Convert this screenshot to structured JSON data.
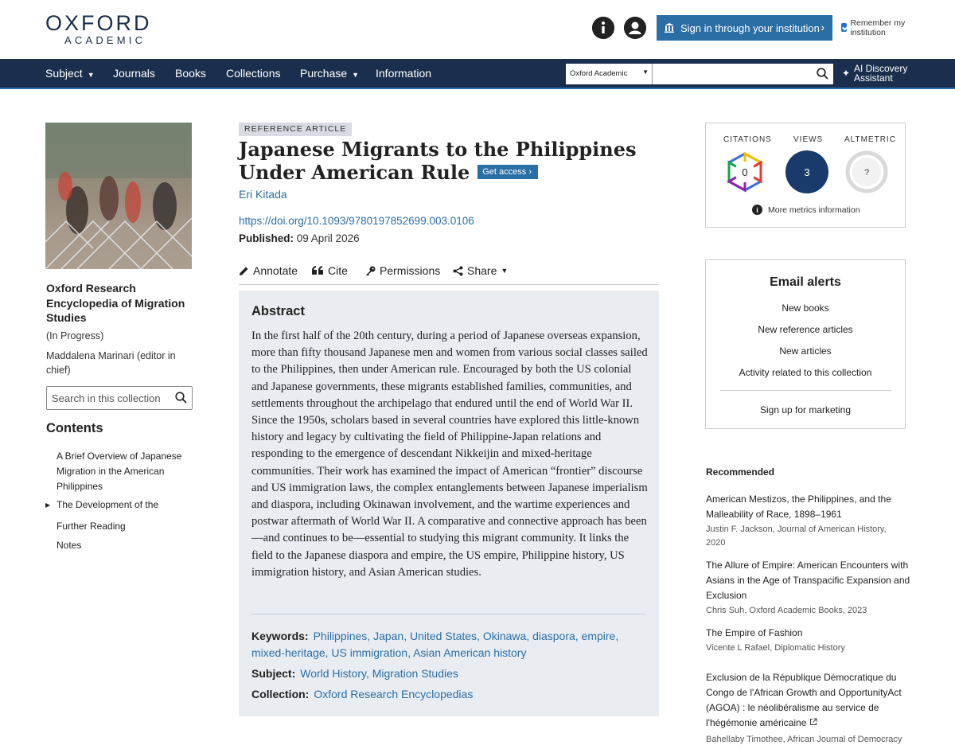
{
  "header": {
    "logo_top": "OXFORD",
    "logo_bottom": "ACADEMIC",
    "signin_label": "Sign in through your institution",
    "remember_label": "Remember my institution"
  },
  "nav": {
    "items": [
      "Subject",
      "Journals",
      "Books",
      "Collections",
      "Purchase",
      "Information"
    ],
    "search_scope": "Oxford Academic",
    "ai_label": "AI Discovery Assistant"
  },
  "sidebar": {
    "collection_title": "Oxford Research Encyclopedia of Migration Studies",
    "status": "(In Progress)",
    "editor": "Maddalena Marinari (editor in chief)",
    "search_placeholder": "Search in this collection",
    "contents_heading": "Contents",
    "toc": [
      "A Brief Overview of Japanese Migration in the American Philippines",
      "The Development of the",
      "Further Reading",
      "Notes"
    ]
  },
  "article": {
    "type_label": "REFERENCE ARTICLE",
    "title": "Japanese Migrants to the Philippines Under American Rule",
    "get_access": "Get access",
    "author": "Eri Kitada",
    "doi": "https://doi.org/10.1093/9780197852699.003.0106",
    "published_label": "Published:",
    "published_date": "09 April 2026",
    "tools": [
      "Annotate",
      "Cite",
      "Permissions",
      "Share"
    ],
    "abstract_heading": "Abstract",
    "abstract": "In the first half of the 20th century, during a period of Japanese overseas expansion, more than fifty thousand Japanese men and women from various social classes sailed to the Philippines, then under American rule. Encouraged by both the US colonial and Japanese governments, these migrants established families, communities, and settlements throughout the archipelago that endured until the end of World War II. Since the 1950s, scholars based in several countries have explored this little-known history and legacy by cultivating the field of Philippine-Japan relations and responding to the emergence of descendant Nikkeijin and mixed-heritage communities. Their work has examined the impact of American “frontier” discourse and US immigration laws, the complex entanglements between Japanese imperialism and diaspora, including Okinawan involvement, and the wartime experiences and postwar aftermath of World War II. A comparative and connective approach has been—and continues to be—essential to studying this migrant community. It links the field to the Japanese diaspora and empire, the US empire, Philippine history, US immigration history, and Asian American studies.",
    "keywords_label": "Keywords:",
    "keywords": "Philippines, Japan, United States, Okinawa, diaspora, empire, mixed-heritage, US immigration, Asian American history",
    "subject_label": "Subject:",
    "subjects": "World History, Migration Studies",
    "collection_label": "Collection:",
    "collection": "Oxford Research Encyclopedias"
  },
  "metrics": {
    "citations_label": "CITATIONS",
    "citations_value": "0",
    "views_label": "VIEWS",
    "views_value": "3",
    "altmetric_label": "ALTMETRIC",
    "altmetric_value": "?",
    "more_label": "More metrics information",
    "views_color": "#1a3a6b"
  },
  "alerts": {
    "heading": "Email alerts",
    "items": [
      "New books",
      "New reference articles",
      "New articles",
      "Activity related to this collection"
    ],
    "marketing": "Sign up for marketing"
  },
  "recommended": {
    "heading": "Recommended",
    "items": [
      {
        "title": "American Mestizos, the Philippines, and the Malleability of Race, 1898–1961",
        "meta": "Justin F. Jackson, Journal of American History, 2020"
      },
      {
        "title": "The Allure of Empire: American Encounters with Asians in the Age of Transpacific Expansion and Exclusion",
        "meta": "Chris Suh, Oxford Academic Books, 2023"
      },
      {
        "title": "The Empire of Fashion",
        "meta": "Vicente L Rafael, Diplomatic History"
      },
      {
        "title": "Exclusion de la République Démocratique du Congo de l'African Growth and OpportunityAct (AGOA) : le néolibéralisme au service de l'hégémonie américaine",
        "meta": "Bahellaby Timothee, African Journal of Democracy"
      }
    ]
  },
  "colors": {
    "navy": "#1a2f4e",
    "link": "#2a6ea6",
    "abstract_bg": "#e9edf2"
  }
}
